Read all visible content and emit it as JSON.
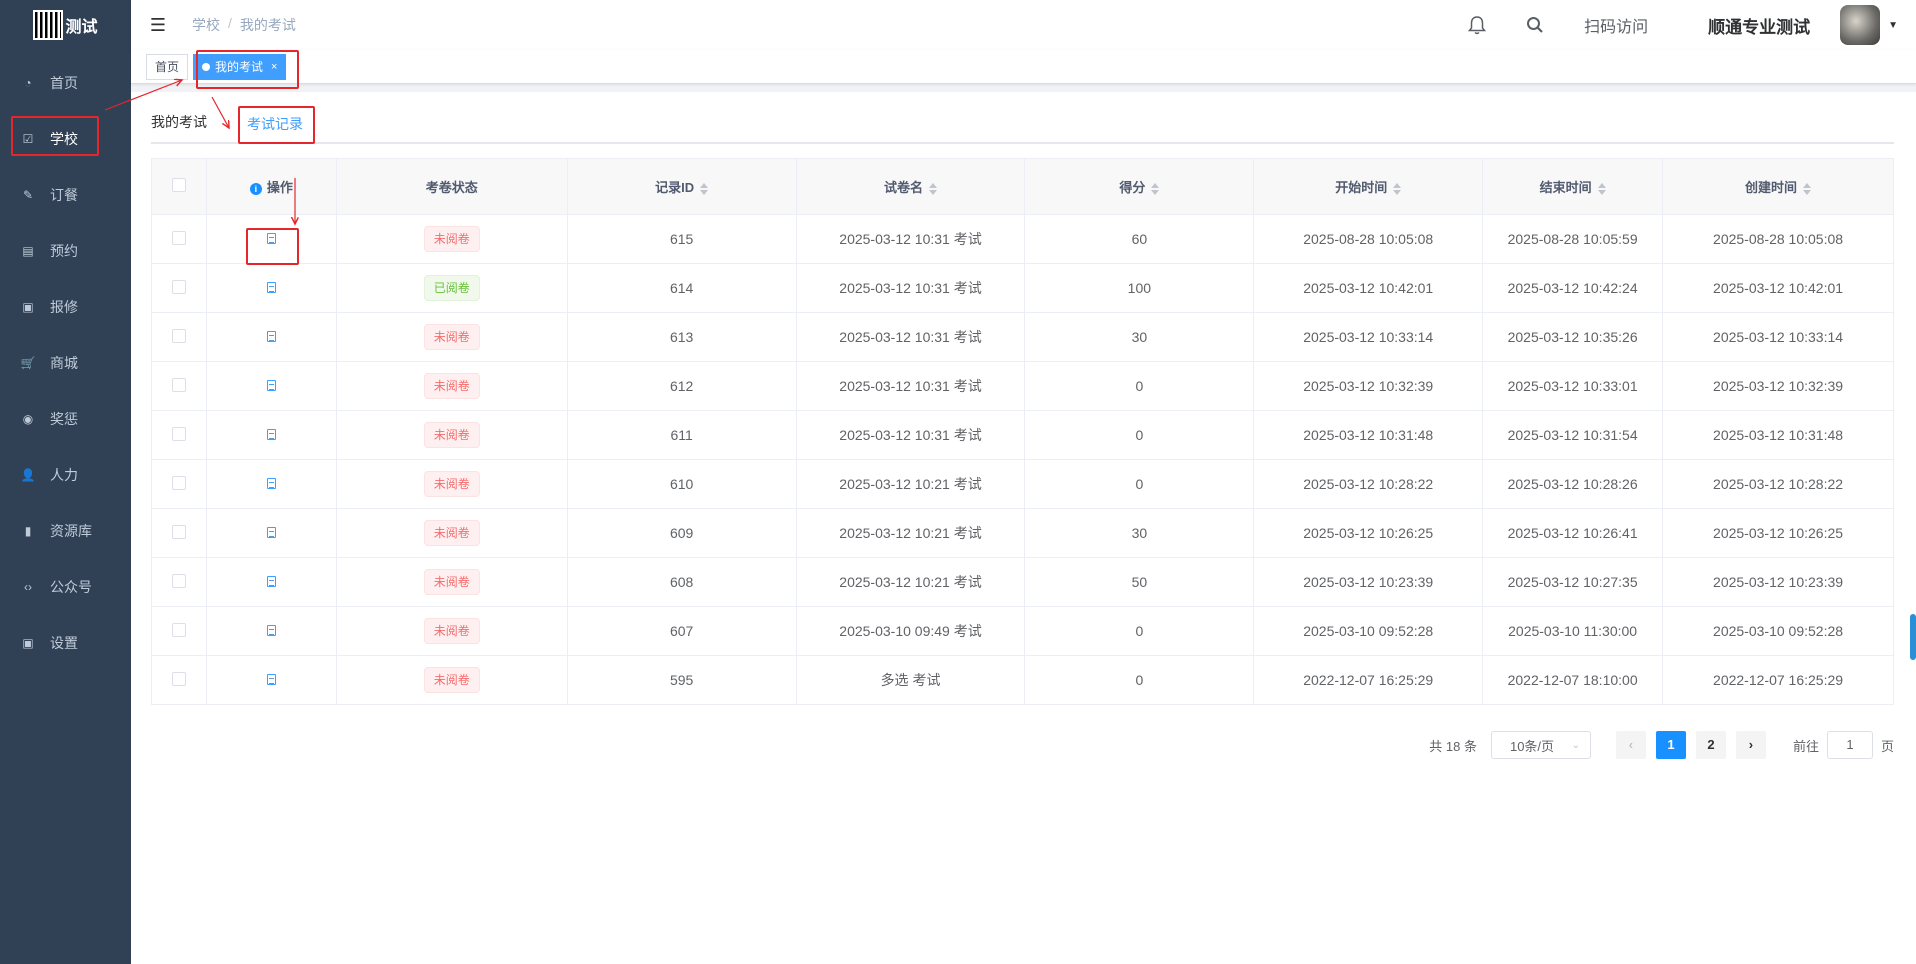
{
  "sidebar": {
    "logo_text": "测试",
    "items": [
      {
        "label": "首页",
        "icon": "dashboard-icon"
      },
      {
        "label": "学校",
        "icon": "checkbox-icon",
        "active": true
      },
      {
        "label": "订餐",
        "icon": "edit-icon"
      },
      {
        "label": "预约",
        "icon": "calendar-icon"
      },
      {
        "label": "报修",
        "icon": "toolbox-icon"
      },
      {
        "label": "商城",
        "icon": "cart-icon"
      },
      {
        "label": "奖惩",
        "icon": "eye-icon"
      },
      {
        "label": "人力",
        "icon": "people-icon"
      },
      {
        "label": "资源库",
        "icon": "bar-chart-icon"
      },
      {
        "label": "公众号",
        "icon": "code-icon"
      },
      {
        "label": "设置",
        "icon": "settings-icon"
      }
    ]
  },
  "navbar": {
    "breadcrumb": [
      "学校",
      "我的考试"
    ],
    "scan_label": "扫码访问",
    "user_name": "顺通专业测试"
  },
  "tags": {
    "home": "首页",
    "active": "我的考试",
    "close": "×"
  },
  "subtabs": [
    "我的考试",
    "考试记录"
  ],
  "table": {
    "headers": [
      "操作",
      "考卷状态",
      "记录ID",
      "试卷名",
      "得分",
      "开始时间",
      "结束时间",
      "创建时间"
    ],
    "rows": [
      {
        "status": "未阅卷",
        "status_type": "danger",
        "id": "615",
        "name": "2025-03-12 10:31 考试",
        "score": "60",
        "start": "2025-08-28 10:05:08",
        "end": "2025-08-28 10:05:59",
        "created": "2025-08-28 10:05:08"
      },
      {
        "status": "已阅卷",
        "status_type": "success",
        "id": "614",
        "name": "2025-03-12 10:31 考试",
        "score": "100",
        "start": "2025-03-12 10:42:01",
        "end": "2025-03-12 10:42:24",
        "created": "2025-03-12 10:42:01"
      },
      {
        "status": "未阅卷",
        "status_type": "danger",
        "id": "613",
        "name": "2025-03-12 10:31 考试",
        "score": "30",
        "start": "2025-03-12 10:33:14",
        "end": "2025-03-12 10:35:26",
        "created": "2025-03-12 10:33:14"
      },
      {
        "status": "未阅卷",
        "status_type": "danger",
        "id": "612",
        "name": "2025-03-12 10:31 考试",
        "score": "0",
        "start": "2025-03-12 10:32:39",
        "end": "2025-03-12 10:33:01",
        "created": "2025-03-12 10:32:39"
      },
      {
        "status": "未阅卷",
        "status_type": "danger",
        "id": "611",
        "name": "2025-03-12 10:31 考试",
        "score": "0",
        "start": "2025-03-12 10:31:48",
        "end": "2025-03-12 10:31:54",
        "created": "2025-03-12 10:31:48"
      },
      {
        "status": "未阅卷",
        "status_type": "danger",
        "id": "610",
        "name": "2025-03-12 10:21 考试",
        "score": "0",
        "start": "2025-03-12 10:28:22",
        "end": "2025-03-12 10:28:26",
        "created": "2025-03-12 10:28:22"
      },
      {
        "status": "未阅卷",
        "status_type": "danger",
        "id": "609",
        "name": "2025-03-12 10:21 考试",
        "score": "30",
        "start": "2025-03-12 10:26:25",
        "end": "2025-03-12 10:26:41",
        "created": "2025-03-12 10:26:25"
      },
      {
        "status": "未阅卷",
        "status_type": "danger",
        "id": "608",
        "name": "2025-03-12 10:21 考试",
        "score": "50",
        "start": "2025-03-12 10:23:39",
        "end": "2025-03-12 10:27:35",
        "created": "2025-03-12 10:23:39"
      },
      {
        "status": "未阅卷",
        "status_type": "danger",
        "id": "607",
        "name": "2025-03-10 09:49 考试",
        "score": "0",
        "start": "2025-03-10 09:52:28",
        "end": "2025-03-10 11:30:00",
        "created": "2025-03-10 09:52:28"
      },
      {
        "status": "未阅卷",
        "status_type": "danger",
        "id": "595",
        "name": "多选 考试",
        "score": "0",
        "start": "2022-12-07 16:25:29",
        "end": "2022-12-07 18:10:00",
        "created": "2022-12-07 16:25:29"
      }
    ]
  },
  "pagination": {
    "total": "共 18 条",
    "page_size": "10条/页",
    "pages": [
      "1",
      "2"
    ],
    "current": "1",
    "goto_prefix": "前往",
    "goto_value": "1",
    "goto_suffix": "页"
  },
  "colors": {
    "primary": "#409eff",
    "annotation": "#e5262c",
    "sidebar": "#304156"
  }
}
